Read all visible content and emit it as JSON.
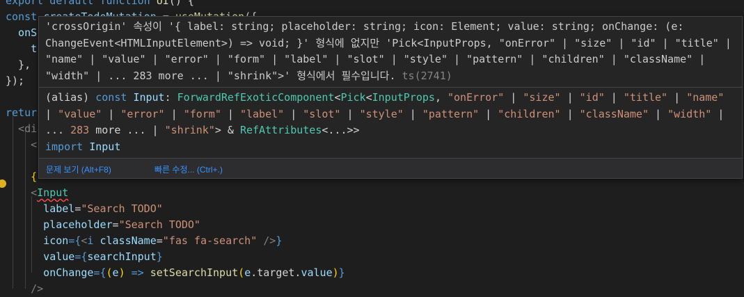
{
  "editor": {
    "lines": [
      [
        {
          "t": "export default function ",
          "c": "k"
        },
        {
          "t": "UI",
          "c": "f"
        },
        {
          "t": "() {",
          "c": "w"
        }
      ],
      [
        {
          "t": "const ",
          "c": "k"
        },
        {
          "t": "createTodoMutation",
          "c": "v"
        },
        {
          "t": " = ",
          "c": "w"
        },
        {
          "t": "useMutation",
          "c": "f"
        },
        {
          "t": "({",
          "c": "w"
        }
      ],
      [
        {
          "t": "  onS",
          "c": "v"
        }
      ],
      [
        {
          "t": "    t",
          "c": "v"
        }
      ],
      [
        {
          "t": "  },",
          "c": "w"
        }
      ],
      [
        {
          "t": "});",
          "c": "w"
        }
      ],
      [
        {
          "t": "",
          "c": "w"
        }
      ],
      [
        {
          "t": "retur",
          "c": "k"
        }
      ],
      [
        {
          "t": "  <di",
          "c": "p"
        }
      ],
      [
        {
          "t": "    <",
          "c": "p"
        }
      ],
      [
        {
          "t": "",
          "c": "w"
        }
      ],
      [
        {
          "t": "    {",
          "c": "y"
        }
      ],
      [
        {
          "t": "    <",
          "c": "p"
        },
        {
          "t": "Input",
          "c": "t",
          "u": true
        }
      ],
      [
        {
          "t": "      label",
          "c": "v"
        },
        {
          "t": "=",
          "c": "w"
        },
        {
          "t": "\"Search TODO\"",
          "c": "s"
        }
      ],
      [
        {
          "t": "      placeholder",
          "c": "v"
        },
        {
          "t": "=",
          "c": "w"
        },
        {
          "t": "\"Search TODO\"",
          "c": "s"
        }
      ],
      [
        {
          "t": "      icon",
          "c": "v"
        },
        {
          "t": "={",
          "c": "k"
        },
        {
          "t": "<",
          "c": "p"
        },
        {
          "t": "i ",
          "c": "k"
        },
        {
          "t": "className",
          "c": "v"
        },
        {
          "t": "=",
          "c": "w"
        },
        {
          "t": "\"fas fa-search\"",
          "c": "s"
        },
        {
          "t": " />",
          "c": "p"
        },
        {
          "t": "}",
          "c": "k"
        }
      ],
      [
        {
          "t": "      value",
          "c": "v"
        },
        {
          "t": "={",
          "c": "k"
        },
        {
          "t": "searchInput",
          "c": "v"
        },
        {
          "t": "}",
          "c": "k"
        }
      ],
      [
        {
          "t": "      onChange",
          "c": "v"
        },
        {
          "t": "={",
          "c": "k"
        },
        {
          "t": "(",
          "c": "y"
        },
        {
          "t": "e",
          "c": "v"
        },
        {
          "t": ")",
          "c": "y"
        },
        {
          "t": " => ",
          "c": "k"
        },
        {
          "t": "setSearchInput",
          "c": "f"
        },
        {
          "t": "(",
          "c": "y"
        },
        {
          "t": "e",
          "c": "v"
        },
        {
          "t": ".target.",
          "c": "w"
        },
        {
          "t": "value",
          "c": "v"
        },
        {
          "t": ")",
          "c": "y"
        },
        {
          "t": "}",
          "c": "k"
        }
      ],
      [
        {
          "t": "    />",
          "c": "p"
        }
      ]
    ]
  },
  "hover": {
    "error_message": "'crossOrigin' 속성이 '{ label: string; placeholder: string; icon: Element; value: string; onChange: (e: ChangeEvent<HTMLInputElement>) => void; }' 형식에 없지만 'Pick<InputProps, \"onError\" | \"size\" | \"id\" | \"title\" | \"name\" | \"value\" | \"error\" | \"form\" | \"label\" | \"slot\" | \"style\" | \"pattern\" | \"children\" | \"className\" | \"width\" | ... 283 more ... | \"shrink\">' 형식에서 필수입니다.",
    "error_code": "ts(2741)",
    "signature": [
      {
        "t": "(alias) ",
        "c": "w"
      },
      {
        "t": "const ",
        "c": "k"
      },
      {
        "t": "Input",
        "c": "v"
      },
      {
        "t": ": ",
        "c": "w"
      },
      {
        "t": "ForwardRefExoticComponent",
        "c": "t"
      },
      {
        "t": "<",
        "c": "w"
      },
      {
        "t": "Pick",
        "c": "t"
      },
      {
        "t": "<",
        "c": "w"
      },
      {
        "t": "InputProps",
        "c": "t"
      },
      {
        "t": ", ",
        "c": "w"
      },
      {
        "t": "\"onError\"",
        "c": "s"
      },
      {
        "t": " | ",
        "c": "w"
      },
      {
        "t": "\"size\"",
        "c": "s"
      },
      {
        "t": " | ",
        "c": "w"
      },
      {
        "t": "\"id\"",
        "c": "s"
      },
      {
        "t": " | ",
        "c": "w"
      },
      {
        "t": "\"title\"",
        "c": "s"
      },
      {
        "t": " | ",
        "c": "w"
      },
      {
        "t": "\"name\"",
        "c": "s"
      },
      {
        "t": " | ",
        "c": "w"
      },
      {
        "t": "\"value\"",
        "c": "s"
      },
      {
        "t": " | ",
        "c": "w"
      },
      {
        "t": "\"error\"",
        "c": "s"
      },
      {
        "t": " | ",
        "c": "w"
      },
      {
        "t": "\"form\"",
        "c": "s"
      },
      {
        "t": " | ",
        "c": "w"
      },
      {
        "t": "\"label\"",
        "c": "s"
      },
      {
        "t": " | ",
        "c": "w"
      },
      {
        "t": "\"slot\"",
        "c": "s"
      },
      {
        "t": " | ",
        "c": "w"
      },
      {
        "t": "\"style\"",
        "c": "s"
      },
      {
        "t": " | ",
        "c": "w"
      },
      {
        "t": "\"pattern\"",
        "c": "s"
      },
      {
        "t": " | ",
        "c": "w"
      },
      {
        "t": "\"children\"",
        "c": "s"
      },
      {
        "t": " | ",
        "c": "w"
      },
      {
        "t": "\"className\"",
        "c": "s"
      },
      {
        "t": " | ",
        "c": "w"
      },
      {
        "t": "\"width\"",
        "c": "s"
      },
      {
        "t": " | ... ",
        "c": "w"
      },
      {
        "t": "283",
        "c": "n"
      },
      {
        "t": " more ... | ",
        "c": "w"
      },
      {
        "t": "\"shrink\"",
        "c": "s"
      },
      {
        "t": "> & ",
        "c": "w"
      },
      {
        "t": "RefAttributes",
        "c": "t"
      },
      {
        "t": "<...>>",
        "c": "w"
      }
    ],
    "import_line": [
      {
        "t": "import ",
        "c": "k"
      },
      {
        "t": "Input",
        "c": "v"
      }
    ],
    "actions": {
      "view_problem": "문제 보기 (Alt+F8)",
      "quick_fix": "빠른 수정... (Ctrl+.)"
    }
  }
}
